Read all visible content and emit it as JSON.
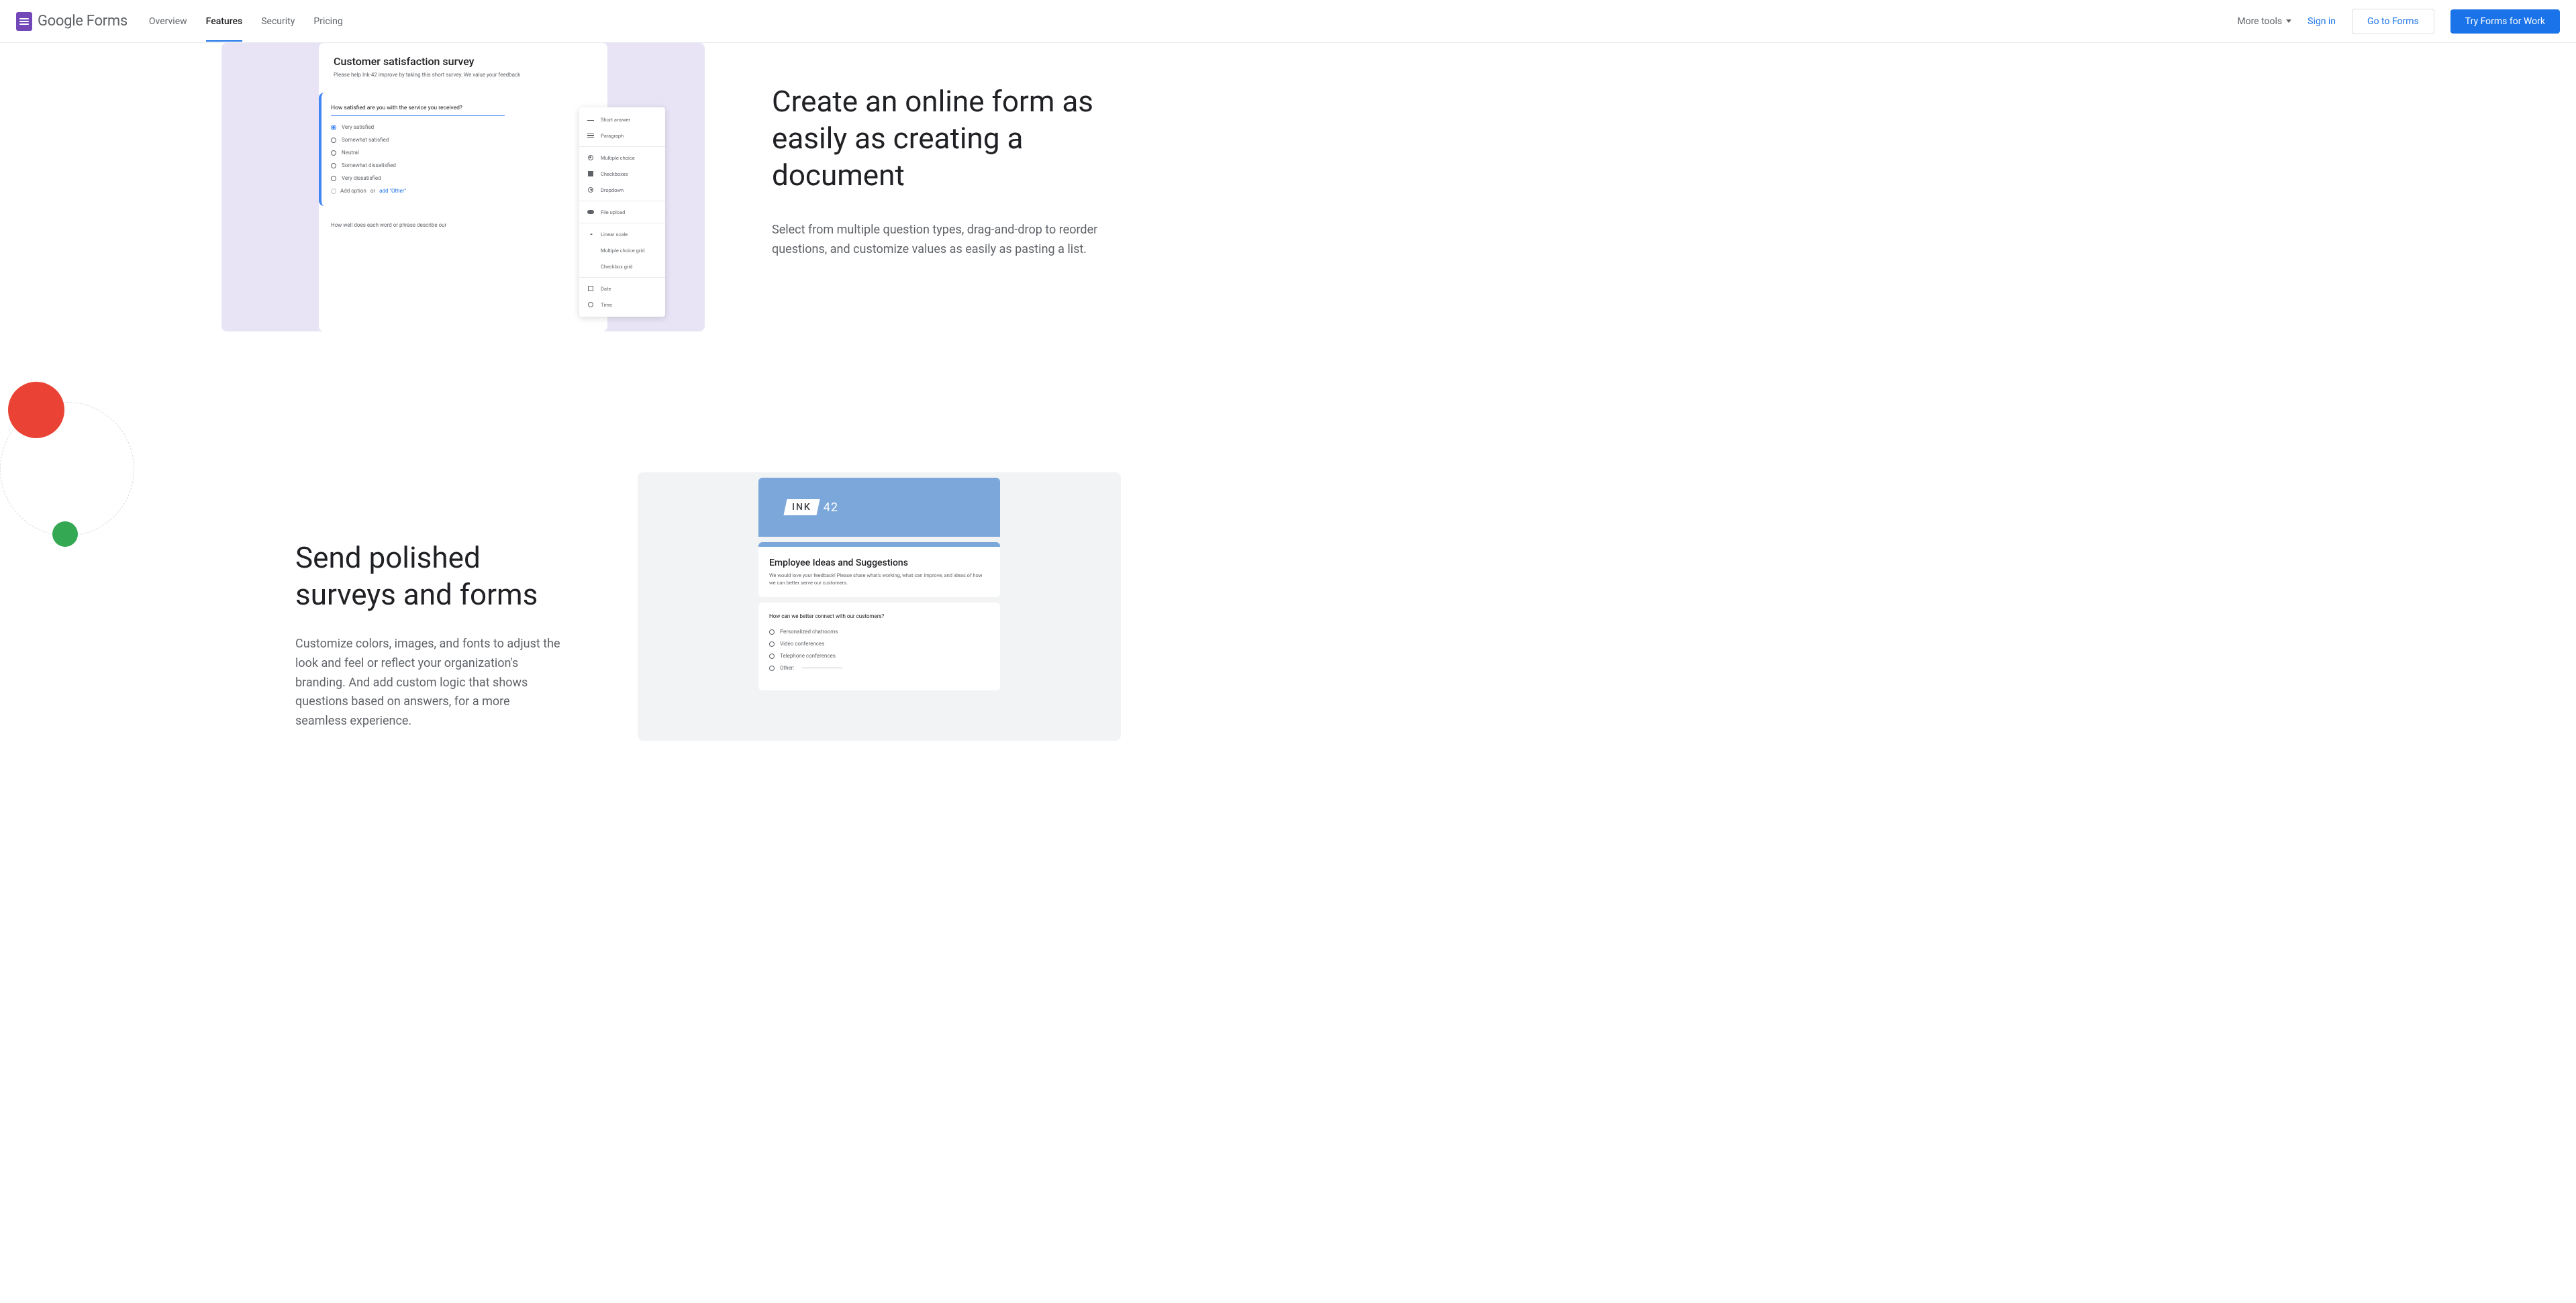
{
  "header": {
    "logo_text": "Google Forms",
    "nav": {
      "overview": "Overview",
      "features": "Features",
      "security": "Security",
      "pricing": "Pricing"
    },
    "more_tools": "More tools",
    "sign_in": "Sign in",
    "go_to_forms": "Go to Forms",
    "try_for_work": "Try Forms for Work"
  },
  "section1": {
    "heading": "Create an online form as easily as creating a document",
    "body": "Select from multiple question types, drag-and-drop to reorder questions, and customize values as easily as pasting a list.",
    "mock": {
      "title": "Customer satisfaction survey",
      "sub": "Please help Ink-42 improve by taking this short survey. We value your feedback",
      "question": "How satisfied are you with the service you received?",
      "options": {
        "o1": "Very satisfied",
        "o2": "Somewhat satisfied",
        "o3": "Neutral",
        "o4": "Somewhat dissatisfied",
        "o5": "Very dissatisfied"
      },
      "add_option": "Add option",
      "or": "or",
      "add_other": "add \"Other\"",
      "q2": "How well does each word or phrase describe our",
      "qtypes": {
        "short_answer": "Short answer",
        "paragraph": "Paragraph",
        "multiple_choice": "Multiple choice",
        "checkboxes": "Checkboxes",
        "dropdown": "Dropdown",
        "file_upload": "File upload",
        "linear_scale": "Linear scale",
        "mc_grid": "Multiple choice grid",
        "cb_grid": "Checkbox grid",
        "date": "Date",
        "time": "Time"
      }
    }
  },
  "section2": {
    "heading": "Send polished surveys and forms",
    "body": "Customize colors, images, and fonts to adjust the look and feel or reflect your organization's branding. And add custom logic that shows questions based on answers, for a more seamless experience.",
    "mock": {
      "brand": "INK",
      "brand_num": "42",
      "title": "Employee Ideas and Suggestions",
      "sub": "We would love your feedback! Please share what's working, what can improve, and ideas of how we can better serve our customers.",
      "question": "How can we better connect with our customers?",
      "options": {
        "o1": "Personalized chatrooms",
        "o2": "Video conferences",
        "o3": "Telephone conferences",
        "o4": "Other:"
      }
    }
  }
}
